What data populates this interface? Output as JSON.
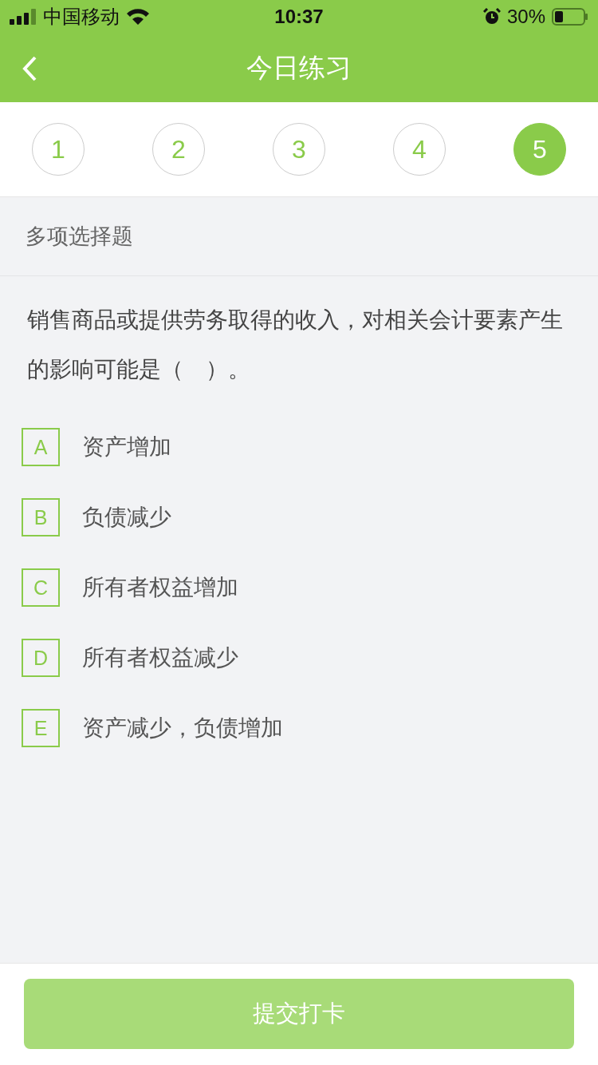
{
  "status_bar": {
    "carrier": "中国移动",
    "time": "10:37",
    "battery": "30%"
  },
  "nav": {
    "title": "今日练习"
  },
  "steps": [
    {
      "label": "1",
      "selected": false
    },
    {
      "label": "2",
      "selected": false
    },
    {
      "label": "3",
      "selected": false
    },
    {
      "label": "4",
      "selected": false
    },
    {
      "label": "5",
      "selected": true
    }
  ],
  "question": {
    "type": "多项选择题",
    "text": "销售商品或提供劳务取得的收入，对相关会计要素产生的影响可能是（　）。",
    "options": [
      {
        "letter": "A",
        "text": "资产增加",
        "selected": false
      },
      {
        "letter": "B",
        "text": "负债减少",
        "selected": false
      },
      {
        "letter": "C",
        "text": "所有者权益增加",
        "selected": false
      },
      {
        "letter": "D",
        "text": "所有者权益减少",
        "selected": false
      },
      {
        "letter": "E",
        "text": "资产减少，负债增加",
        "selected": false
      }
    ]
  },
  "submit": {
    "label": "提交打卡",
    "disabled": true
  }
}
